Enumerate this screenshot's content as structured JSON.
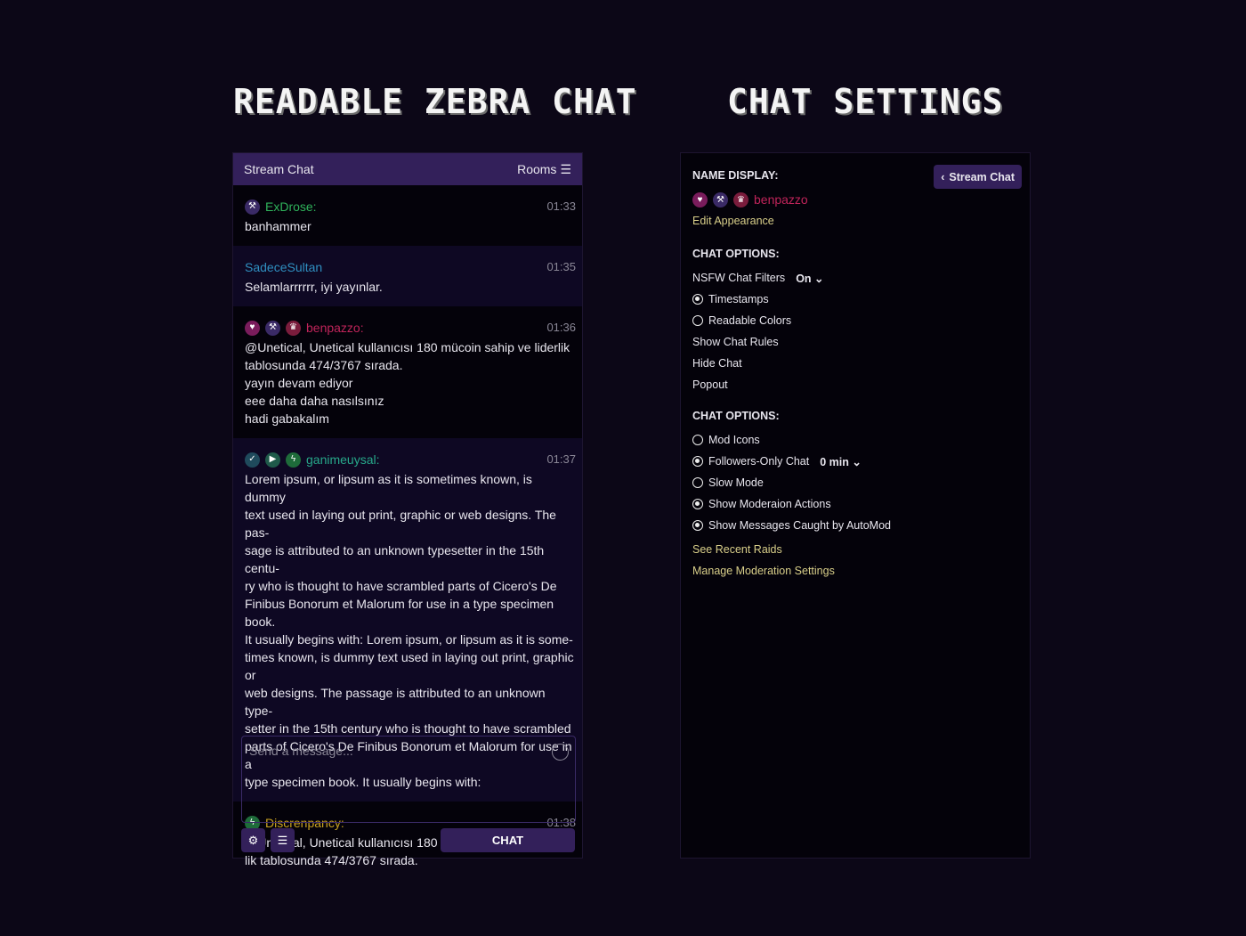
{
  "titles": {
    "chat": "Readable Zebra Chat",
    "settings": "Chat Settings"
  },
  "chat": {
    "header": "Stream Chat",
    "rooms": "Rooms",
    "messages": [
      {
        "user": "ExDrose:",
        "color": "#2fb35b",
        "time": "01:33",
        "badges": [
          "mod"
        ],
        "lines": [
          "banhammer"
        ],
        "alt": false
      },
      {
        "user": "SadeceSultan",
        "color": "#2f8fc0",
        "time": "01:35",
        "badges": [],
        "lines": [
          "Selamlarrrrrr, iyi yayınlar."
        ],
        "alt": true
      },
      {
        "user": "benpazzo:",
        "color": "#c0245a",
        "time": "01:36",
        "badges": [
          "heart",
          "mod",
          "crown"
        ],
        "lines": [
          "@Unetical, Unetical kullanıcısı 180 mücoin sahip ve liderlik",
          "tablosunda 474/3767 sırada.",
          "yayın devam ediyor",
          "eee daha daha nasılsınız",
          "hadi gabakalım"
        ],
        "alt": false
      },
      {
        "user": "ganimeuysal:",
        "color": "#27a88a",
        "time": "01:37",
        "badges": [
          "verified",
          "play",
          "bolt"
        ],
        "lines": [
          "Lorem ipsum, or lipsum as it is sometimes known, is dummy",
          "text used in laying out print, graphic or web designs. The pas-",
          "sage is attributed to an unknown typesetter in the 15th centu-",
          "ry who is thought to have scrambled parts of Cicero's De",
          "Finibus Bonorum et Malorum for use in a type specimen book.",
          "It usually begins with: Lorem ipsum, or lipsum as it is some-",
          "times known, is dummy text used in laying out print, graphic or",
          "web designs. The passage is attributed to an unknown type-",
          "setter in the 15th century who is thought to have scrambled",
          "parts of Cicero's De Finibus Bonorum et Malorum for use in a",
          "type specimen book. It usually begins with:"
        ],
        "alt": true
      },
      {
        "user": "Discrenpancy:",
        "color": "#c9a322",
        "time": "01:38",
        "badges": [
          "bolt"
        ],
        "lines": [
          "@Unetical, Unetical kullanıcısı 180 mücoin sahip ve lider-",
          "lik tablosunda 474/3767 sırada."
        ],
        "alt": false
      }
    ],
    "placeholder": "Send a message...",
    "chat_button": "CHAT"
  },
  "settings": {
    "back": "Stream Chat",
    "name_display": "NAME DISPLAY:",
    "username": "benpazzo",
    "username_color": "#c0245a",
    "edit": "Edit Appearance",
    "section1": "CHAT OPTIONS:",
    "nsfw": "NSFW Chat Filters",
    "nsfw_value": "On",
    "timestamps": "Timestamps",
    "readable": "Readable Colors",
    "rules": "Show Chat Rules",
    "hide": "Hide Chat",
    "popout": "Popout",
    "section2": "CHAT OPTIONS:",
    "mod_icons": "Mod Icons",
    "followers": "Followers-Only Chat",
    "followers_value": "0 min",
    "slow": "Slow Mode",
    "mod_actions": "Show Moderaion Actions",
    "automod": "Show Messages Caught by AutoMod",
    "raids": "See Recent Raids",
    "manage": "Manage Moderation Settings"
  },
  "colors": {
    "accent": "#33205a",
    "link": "#d9cf8a"
  }
}
